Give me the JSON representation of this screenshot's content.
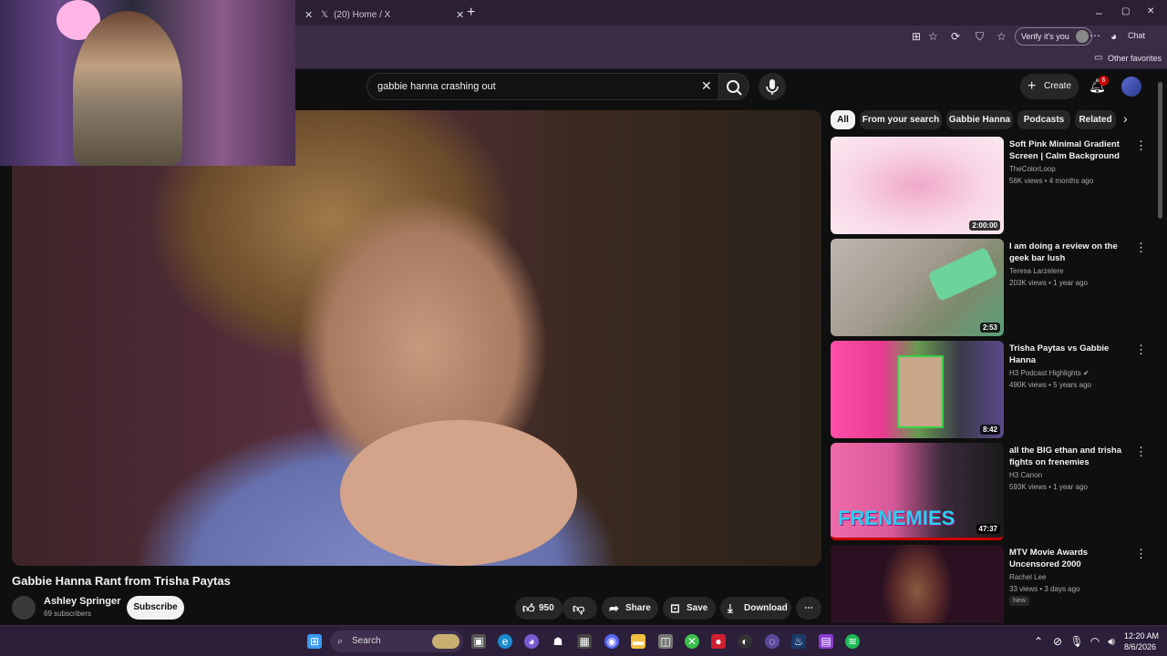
{
  "browser": {
    "tabs": [
      {
        "label": ""
      },
      {
        "label": "(20) Home / X"
      }
    ],
    "new_tab": "+",
    "verify_label": "Verify it's you",
    "chat_label": "Chat",
    "other_favorites": "Other favorites",
    "window_controls": [
      "–",
      "▢",
      "✕"
    ]
  },
  "youtube": {
    "search_value": "gabbie hanna crashing out",
    "create_label": "Create",
    "notification_count": "6",
    "video": {
      "title": "Gabbie Hanna Rant from Trisha Paytas",
      "channel": "Ashley Springer",
      "subscribers": "69 subscribers",
      "subscribe_label": "Subscribe",
      "like_count": "950",
      "share_label": "Share",
      "save_label": "Save",
      "download_label": "Download"
    },
    "chips": [
      "All",
      "From your search",
      "Gabbie Hanna",
      "Podcasts",
      "Related"
    ],
    "related": [
      {
        "title": "Soft Pink Minimal Gradient Screen | Calm Background for ...",
        "channel": "TheColorLoop",
        "meta": "56K views • 4 months ago",
        "duration": "2:00:00"
      },
      {
        "title": "I am doing a review on the geek bar lush",
        "channel": "Teresa Larzelere",
        "meta": "203K views • 1 year ago",
        "duration": "2:53"
      },
      {
        "title": "Trisha Paytas vs Gabbie Hanna",
        "channel": "H3 Podcast Highlights",
        "meta": "490K views • 5 years ago",
        "duration": "8:42"
      },
      {
        "title": "all the BIG ethan and trisha fights on frenemies",
        "channel": "H3 Canon",
        "meta": "593K views • 1 year ago",
        "duration": "47:37"
      },
      {
        "title": "MTV Movie Awards Uncensored 2000",
        "channel": "Rachel Lee",
        "meta": "33 views • 3 days ago",
        "badge": "New"
      }
    ],
    "thumb_text_frenemies": "FRENEMIES"
  },
  "taskbar": {
    "search_label": "Search",
    "time": "12:20 AM",
    "date": "8/6/2026"
  },
  "colors": {
    "yt_bg": "#0f0f0f",
    "accent_red": "#cc0000",
    "taskbar": "#2c1f3a"
  }
}
